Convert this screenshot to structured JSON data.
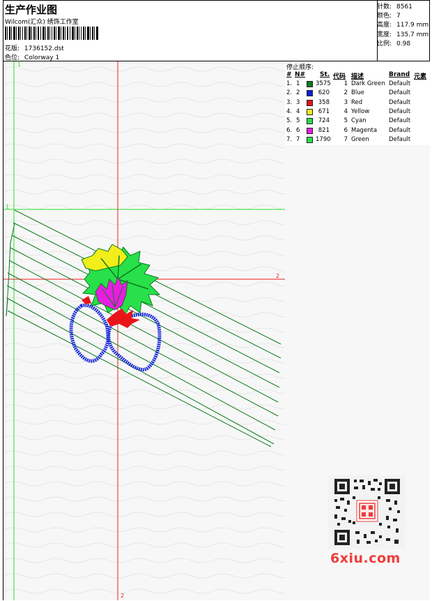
{
  "header": {
    "title": "生产作业图",
    "company": "Wilcom(汇众) 绣饰工作室",
    "design_label": "花版:",
    "design_value": "1736152.dst",
    "colorway_label": "色位:",
    "colorway_value": "Colorway 1"
  },
  "stats": [
    {
      "label": "针数:",
      "value": "8561"
    },
    {
      "label": "颜色:",
      "value": "7"
    },
    {
      "label": "高度:",
      "value": "117.9 mm"
    },
    {
      "label": "宽度:",
      "value": "135.7 mm"
    },
    {
      "label": "比例:",
      "value": "0.98"
    }
  ],
  "stop_sequence": {
    "title": "停止顺序:",
    "columns": [
      "#",
      "N#",
      "St.",
      "代码",
      "描述",
      "Brand",
      "元素"
    ],
    "rows": [
      {
        "idx": "1.",
        "n": "1",
        "st": "3575",
        "code": "1",
        "desc": "Dark Green",
        "brand": "Default",
        "color": "#0a7a1e"
      },
      {
        "idx": "2.",
        "n": "2",
        "st": "620",
        "code": "2",
        "desc": "Blue",
        "brand": "Default",
        "color": "#0a1ed6"
      },
      {
        "idx": "3.",
        "n": "3",
        "st": "358",
        "code": "3",
        "desc": "Red",
        "brand": "Default",
        "color": "#e8141a"
      },
      {
        "idx": "4.",
        "n": "4",
        "st": "671",
        "code": "4",
        "desc": "Yellow",
        "brand": "Default",
        "color": "#f2ee1a"
      },
      {
        "idx": "5.",
        "n": "5",
        "st": "724",
        "code": "5",
        "desc": "Cyan",
        "brand": "Default",
        "color": "#28e04a"
      },
      {
        "idx": "6.",
        "n": "6",
        "st": "821",
        "code": "6",
        "desc": "Magenta",
        "brand": "Default",
        "color": "#e81ee0"
      },
      {
        "idx": "7.",
        "n": "7",
        "st": "1790",
        "code": "7",
        "desc": "Green",
        "brand": "Default",
        "color": "#28e04a"
      }
    ]
  },
  "axis_labels": {
    "v_top": "1",
    "h_left": "1",
    "h_right": "2",
    "v_bottom": "2"
  },
  "watermark": {
    "text": "6xiu.com"
  },
  "colors": {
    "axis_green": "#2be02b",
    "axis_red": "#ee1c1c",
    "stitch_green": "#0a7a1e",
    "blue": "#1a2cd8"
  }
}
